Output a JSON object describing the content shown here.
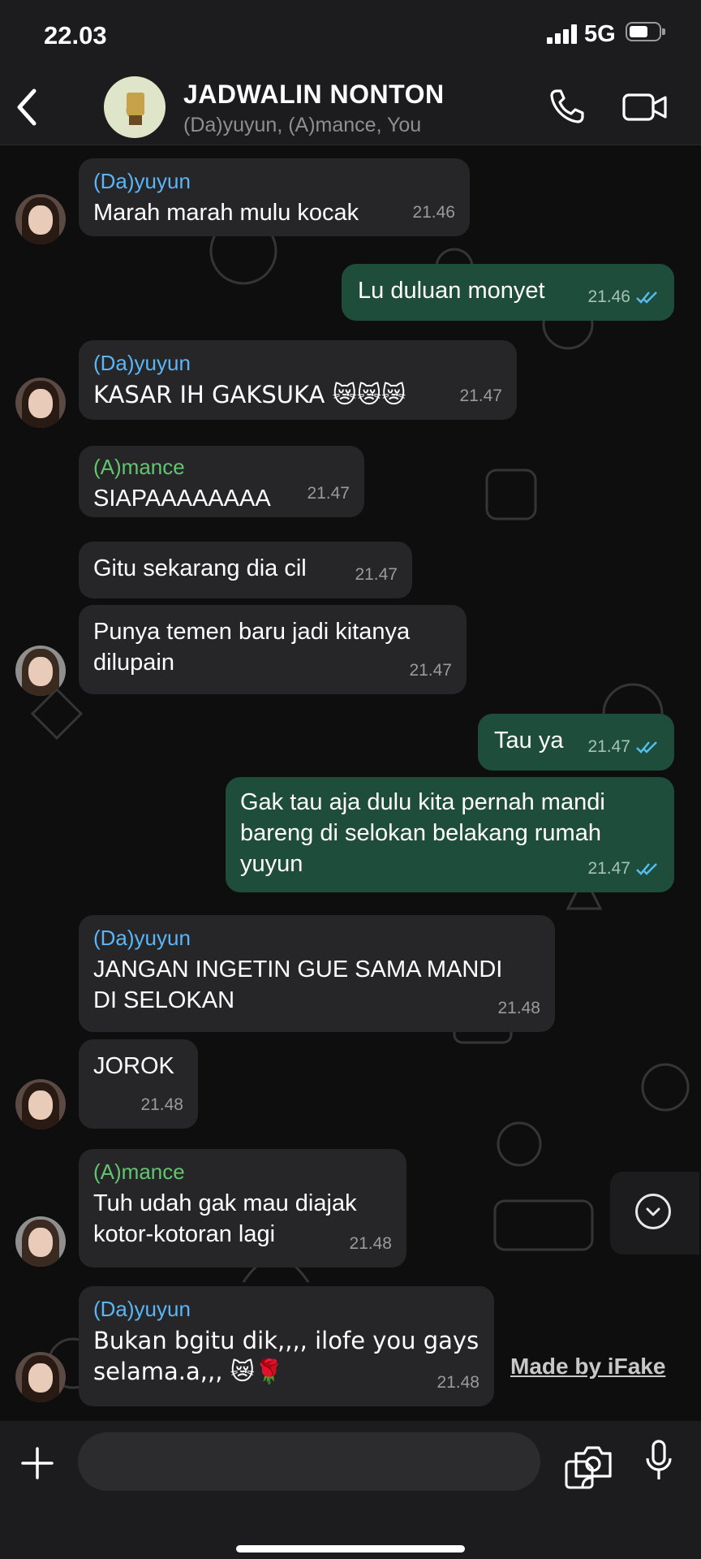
{
  "status_bar": {
    "time": "22.03",
    "network": "5G"
  },
  "header": {
    "title": "JADWALIN NONTON",
    "subtitle": "(Da)yuyun, (A)mance, You"
  },
  "messages": [
    {
      "id": 1,
      "direction": "in",
      "sender": "(Da)yuyun",
      "text": "Marah marah mulu kocak",
      "time": "21.46"
    },
    {
      "id": 2,
      "direction": "out",
      "text": "Lu duluan monyet",
      "time": "21.46"
    },
    {
      "id": 3,
      "direction": "in",
      "sender": "(Da)yuyun",
      "text": "KASAR IH GAKSUKA 😿😿😿",
      "time": "21.47"
    },
    {
      "id": 4,
      "direction": "in",
      "sender": "(A)mance",
      "text": "SIAPAAAAAAAA",
      "time": "21.47"
    },
    {
      "id": 5,
      "direction": "in",
      "text": "Gitu sekarang dia cil",
      "time": "21.47"
    },
    {
      "id": 6,
      "direction": "in",
      "text": "Punya temen baru jadi kitanya\ndilupain",
      "time": "21.47"
    },
    {
      "id": 7,
      "direction": "out",
      "text": "Tau ya",
      "time": "21.47"
    },
    {
      "id": 8,
      "direction": "out",
      "text": "Gak tau aja dulu kita pernah mandi\nbareng di selokan belakang rumah\nyuyun",
      "time": "21.47"
    },
    {
      "id": 9,
      "direction": "in",
      "sender": "(Da)yuyun",
      "text": "JANGAN INGETIN GUE SAMA MANDI\nDI SELOKAN",
      "time": "21.48"
    },
    {
      "id": 10,
      "direction": "in",
      "text": "JOROK",
      "time": "21.48"
    },
    {
      "id": 11,
      "direction": "in",
      "sender": "(A)mance",
      "text": "Tuh udah gak mau diajak\nkotor-kotoran lagi",
      "time": "21.48"
    },
    {
      "id": 12,
      "direction": "in",
      "sender": "(Da)yuyun",
      "text": "Bukan bgitu dik,,,, ilofe you gays\nselama.a,,, 😿🌹",
      "time": "21.48"
    }
  ],
  "watermark": "Made by iFake",
  "icons": {
    "back": "chevron-left-icon",
    "call": "phone-icon",
    "video": "video-camera-icon",
    "scroll": "chevron-down-icon",
    "attach": "plus-icon",
    "sticker": "sticker-icon",
    "camera": "camera-icon",
    "mic": "microphone-icon"
  },
  "colors": {
    "incoming_bubble": "#262628",
    "outgoing_bubble": "#1f4d3b",
    "sender_dayuyun": "#5ab6f7",
    "sender_amance": "#62c56f",
    "read_ticks": "#53bdeb"
  }
}
